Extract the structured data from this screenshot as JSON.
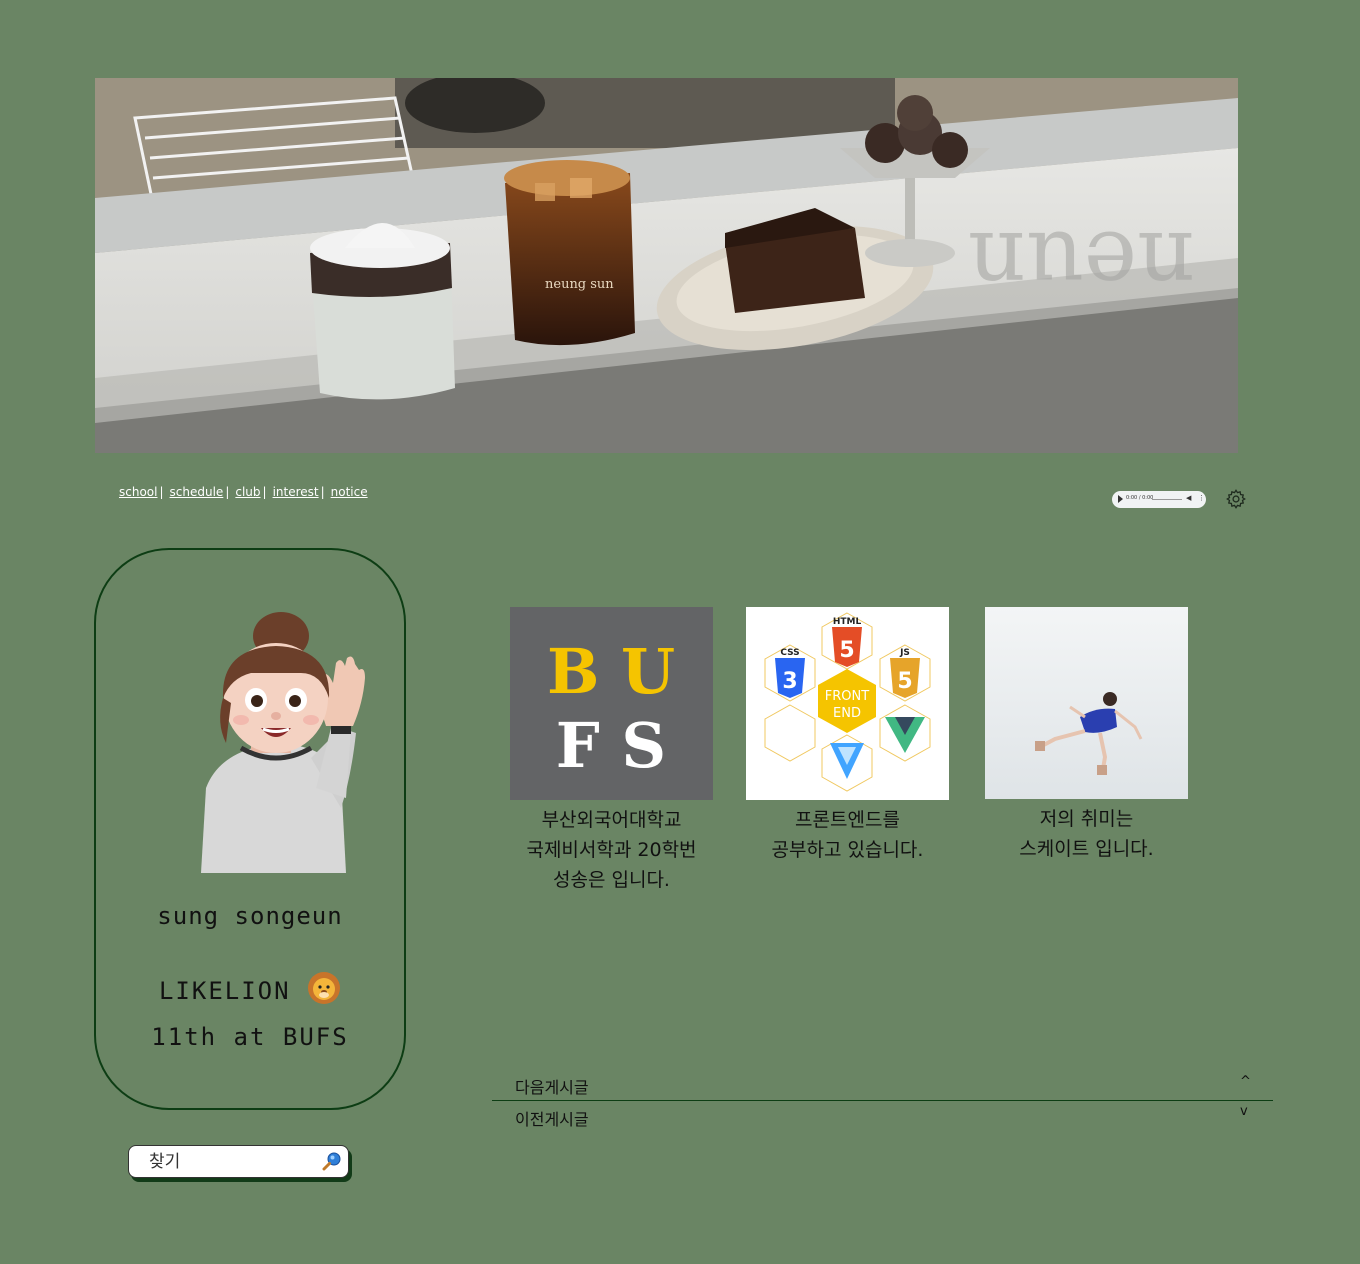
{
  "nav": {
    "items": [
      {
        "label": "school"
      },
      {
        "label": "schedule"
      },
      {
        "label": "club"
      },
      {
        "label": "interest"
      },
      {
        "label": "notice"
      }
    ],
    "separator": "|"
  },
  "audio": {
    "time": "0:00 / 0:00"
  },
  "banner": {
    "cup_text": "neung sun",
    "window_text": "neun"
  },
  "profile": {
    "name": "sung songeun",
    "club_line1": "LIKELION",
    "club_line2": "11th at BUFS",
    "club_emoji": "lion-face"
  },
  "search": {
    "placeholder": "찾기"
  },
  "cards": [
    {
      "logo_line1": "B U",
      "logo_line2": "F S",
      "caption": [
        "부산외국어대학교",
        "국제비서학과 20학번",
        "성송은 입니다."
      ]
    },
    {
      "html": "HTML",
      "css": "CSS",
      "js": "JS",
      "center_line1": "FRONT",
      "center_line2": "END",
      "caption": [
        "프론트엔드를",
        "공부하고 있습니다."
      ]
    },
    {
      "caption": [
        "저의 취미는",
        "스케이트 입니다."
      ]
    }
  ],
  "post_nav": {
    "next_label": "다음게시글",
    "next_arrow": "^",
    "prev_label": "이전게시글",
    "prev_arrow": "v"
  },
  "colors": {
    "background": "#6a8564",
    "border": "#0d3d14",
    "bufs_yellow": "#f5c400",
    "bufs_gray": "#636466"
  }
}
